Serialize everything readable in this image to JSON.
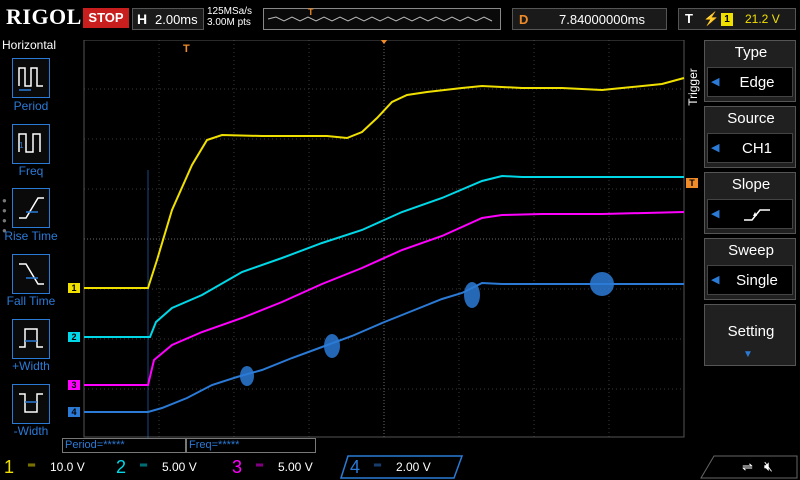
{
  "brand": "RIGOL",
  "run_state": "STOP",
  "horizontal": {
    "label": "H",
    "timebase": "2.00ms",
    "sample_rate": "125MSa/s",
    "points": "3.00M pts"
  },
  "delay": {
    "label": "D",
    "value": "7.84000000ms"
  },
  "trigger_status": {
    "label": "T",
    "edge_icon": "rising-edge-icon",
    "channel": "1",
    "level": "21.2 V"
  },
  "left_menu": {
    "title": "Horizontal",
    "items": [
      {
        "label": "Period",
        "icon": "period-icon"
      },
      {
        "label": "Freq",
        "icon": "freq-icon"
      },
      {
        "label": "Rise Time",
        "icon": "rise-time-icon"
      },
      {
        "label": "Fall Time",
        "icon": "fall-time-icon"
      },
      {
        "label": "+Width",
        "icon": "pos-width-icon"
      },
      {
        "label": "-Width",
        "icon": "neg-width-icon"
      }
    ]
  },
  "measurements": [
    {
      "label": "Period=*****"
    },
    {
      "label": "Freq=*****"
    }
  ],
  "trigger_menu": {
    "side_label": "Trigger",
    "items": [
      {
        "title": "Type",
        "value": "Edge"
      },
      {
        "title": "Source",
        "value": "CH1"
      },
      {
        "title": "Slope",
        "value": "rising-slope-icon"
      },
      {
        "title": "Sweep",
        "value": "Single"
      },
      {
        "title": "Setting",
        "value": ""
      }
    ]
  },
  "channels": [
    {
      "num": "1",
      "scale": "10.0 V",
      "color": "#f0e000"
    },
    {
      "num": "2",
      "scale": "5.00 V",
      "color": "#00d8e8"
    },
    {
      "num": "3",
      "scale": "5.00 V",
      "color": "#ff00ff"
    },
    {
      "num": "4",
      "scale": "2.00 V",
      "color": "#2b7ad6"
    }
  ],
  "markers": {
    "trigger_pos": "T"
  },
  "status_icons": [
    "usb-icon",
    "speaker-mute-icon"
  ]
}
